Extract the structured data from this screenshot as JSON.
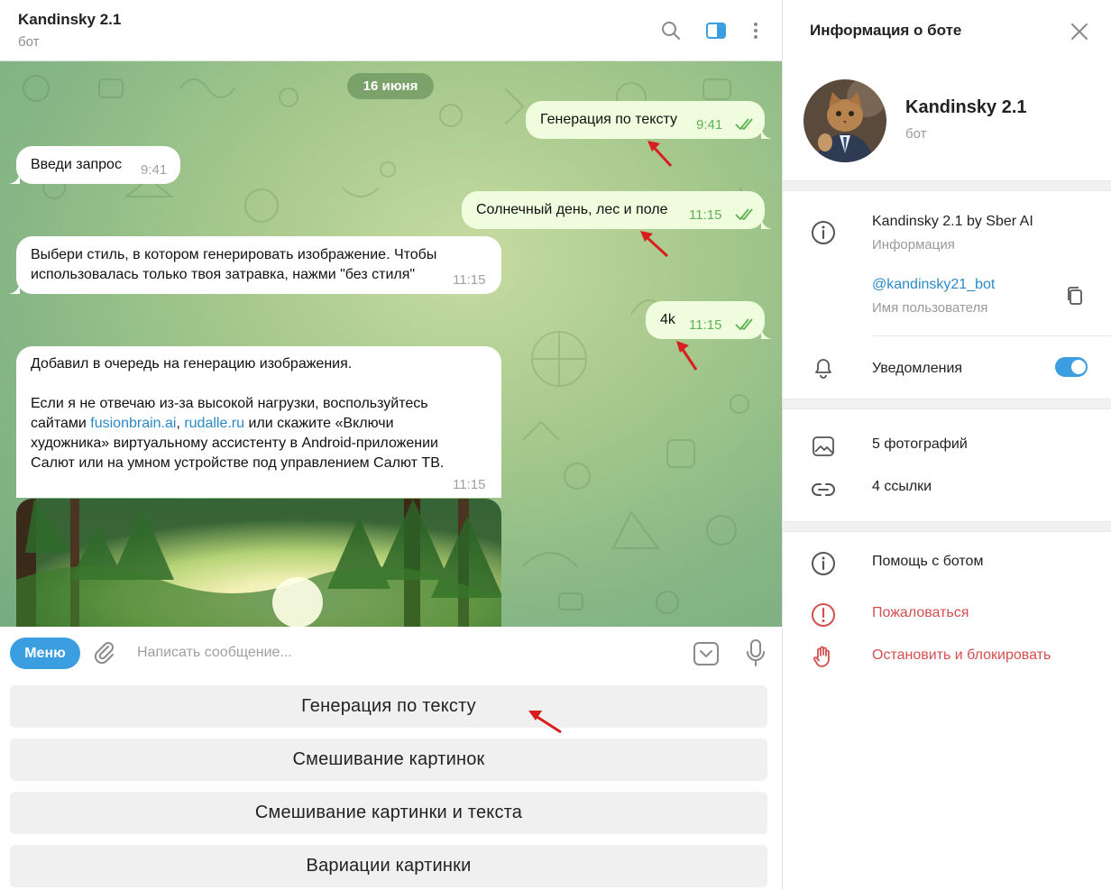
{
  "chat": {
    "title": "Kandinsky 2.1",
    "subtitle": "бот",
    "date_pill": "16 июня",
    "messages": [
      {
        "side": "out",
        "text": "Генерация по тексту",
        "time": "9:41"
      },
      {
        "side": "in",
        "text": "Введи запрос",
        "time": "9:41"
      },
      {
        "side": "out",
        "text": "Солнечный день, лес и поле",
        "time": "11:15"
      },
      {
        "side": "in",
        "lines": [
          "Выбери стиль, в котором генерировать изображение. Чтобы",
          "использовалась только твоя затравка, нажми \"без стиля\""
        ],
        "time": "11:15"
      },
      {
        "side": "out",
        "text": "4k",
        "time": "11:15"
      },
      {
        "side": "in",
        "line1": "Добавил в очередь на генерацию изображения.",
        "line2": "Если я не отвечаю из-за высокой нагрузки, воспользуйтесь",
        "line3_prefix": "сайтами ",
        "link1": "fusionbrain.ai",
        "comma": ", ",
        "link2": "rudalle.ru",
        "line3_suffix": " или скажите «Включи",
        "line4": "художника» виртуальному ассистенту в Android-приложении",
        "line5": "Салют или на умном устройстве под управлением Салют ТВ.",
        "time": "11:15"
      }
    ]
  },
  "composer": {
    "menu_label": "Меню",
    "placeholder": "Написать сообщение..."
  },
  "keyboard": {
    "buttons": [
      "Генерация по тексту",
      "Смешивание картинок",
      "Смешивание картинки и текста",
      "Вариации картинки"
    ]
  },
  "info": {
    "title": "Информация о боте",
    "bot_name": "Kandinsky 2.1",
    "bot_sub": "бот",
    "description": "Kandinsky 2.1 by Sber AI",
    "description_label": "Информация",
    "username": "@kandinsky21_bot",
    "username_label": "Имя пользователя",
    "notifications": "Уведомления",
    "notifications_on": true,
    "photos": "5 фотографий",
    "links": "4 ссылки",
    "help": "Помощь с ботом",
    "report": "Пожаловаться",
    "block": "Остановить и блокировать"
  },
  "colors": {
    "accent": "#3a9ee0",
    "danger": "#d35050",
    "outgoing_bubble": "#effdde",
    "annotation_arrow": "#d81e1e"
  }
}
